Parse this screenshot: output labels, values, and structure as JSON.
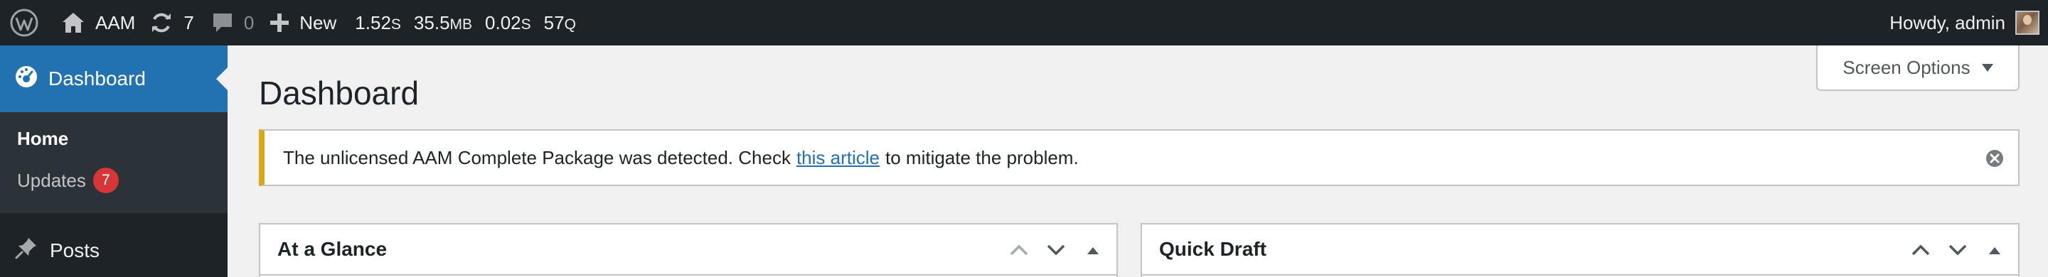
{
  "adminbar": {
    "wp_logo_icon": "wordpress-icon",
    "site_name": "AAM",
    "site_icon": "home-icon",
    "updates_icon": "update-icon",
    "updates_count": "7",
    "comments_icon": "comment-icon",
    "comments_count": "0",
    "new_icon": "plus-icon",
    "new_label": "New",
    "stats": {
      "time": "1.52",
      "time_unit": "S",
      "memory": "35.5",
      "memory_unit": "MB",
      "db_time": "0.02",
      "db_time_unit": "S",
      "queries": "57",
      "queries_unit": "Q"
    },
    "greeting": "Howdy, admin"
  },
  "sidebar": {
    "dashboard_icon": "dashboard-icon",
    "dashboard_label": "Dashboard",
    "submenu": {
      "home_label": "Home",
      "updates_label": "Updates",
      "updates_badge": "7"
    },
    "posts_icon": "pushpin-icon",
    "posts_label": "Posts"
  },
  "screen_options": {
    "label": "Screen Options"
  },
  "main": {
    "title": "Dashboard",
    "notice": {
      "text_before": "The unlicensed AAM Complete Package was detected. Check",
      "link_text": "this article",
      "text_after": "to mitigate the problem."
    },
    "widgets": [
      {
        "title": "At a Glance"
      },
      {
        "title": "Quick Draft"
      }
    ]
  },
  "colors": {
    "adminbar_bg": "#1d2327",
    "accent": "#2271b1",
    "notice_warning": "#dba617",
    "badge": "#d63638"
  }
}
